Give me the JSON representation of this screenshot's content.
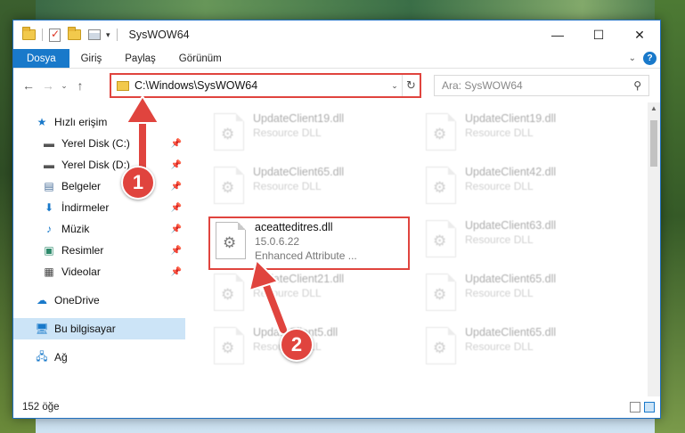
{
  "title_bar": {
    "title": "SysWOW64",
    "minimize": "—",
    "maximize": "☐",
    "close": "✕"
  },
  "ribbon": {
    "tabs": [
      "Dosya",
      "Giriş",
      "Paylaş",
      "Görünüm"
    ],
    "help": "?"
  },
  "address": {
    "path": "C:\\Windows\\SysWOW64",
    "search_placeholder": "Ara: SysWOW64"
  },
  "nav_pane": {
    "quick_access": "Hızlı erişim",
    "pinned": [
      {
        "label": "Yerel Disk (C:)",
        "icon": "drive-icon"
      },
      {
        "label": "Yerel Disk (D:)",
        "icon": "drive-icon"
      },
      {
        "label": "Belgeler",
        "icon": "documents-icon"
      },
      {
        "label": "İndirmeler",
        "icon": "download-icon"
      },
      {
        "label": "Müzik",
        "icon": "music-icon"
      },
      {
        "label": "Resimler",
        "icon": "pictures-icon"
      },
      {
        "label": "Videolar",
        "icon": "video-icon"
      }
    ],
    "onedrive": "OneDrive",
    "this_pc": "Bu bilgisayar",
    "network": "Ağ"
  },
  "files": [
    {
      "name": "UpdateClient19.dll",
      "meta": "Resource DLL",
      "faded": true
    },
    {
      "name": "UpdateClient19.dll",
      "meta": "Resource DLL",
      "faded": true
    },
    {
      "name": "UpdateClient65.dll",
      "meta": "Resource DLL",
      "faded": true
    },
    {
      "name": "UpdateClient42.dll",
      "meta": "Resource DLL",
      "faded": true
    },
    {
      "name": "aceatteditres.dll",
      "version": "15.0.6.22",
      "meta": "Enhanced Attribute ...",
      "faded": false
    },
    {
      "name": "UpdateClient63.dll",
      "meta": "Resource DLL",
      "faded": true
    },
    {
      "name": "UpdateClient21.dll",
      "meta": "Resource DLL",
      "faded": true
    },
    {
      "name": "UpdateClient65.dll",
      "meta": "Resource DLL",
      "faded": true
    },
    {
      "name": "UpdateClient5.dll",
      "meta": "Resource DLL",
      "faded": true
    },
    {
      "name": "UpdateClient65.dll",
      "meta": "Resource DLL",
      "faded": true
    }
  ],
  "status": {
    "count": "152 öğe"
  },
  "steps": [
    "1",
    "2"
  ],
  "colors": {
    "accent": "#1979ca",
    "highlight": "#e0443e"
  }
}
